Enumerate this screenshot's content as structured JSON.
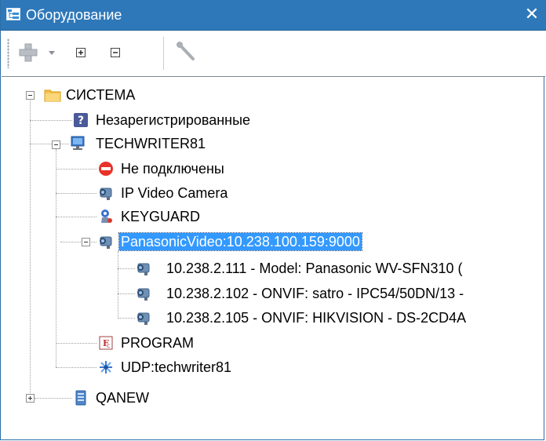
{
  "window": {
    "title": "Оборудование",
    "close_glyph": "✕"
  },
  "toolbar": {
    "add_icon": "add-device-icon",
    "expand_icon": "expand-all-icon",
    "collapse_icon": "collapse-all-icon",
    "tool_icon": "settings-tool-icon"
  },
  "tree": {
    "root": {
      "label": "СИСТЕМА",
      "icon": "folder-icon"
    },
    "unregistered": {
      "label": "Незарегистрированные",
      "icon": "question-icon"
    },
    "computer": {
      "label": "TECHWRITER81",
      "icon": "computer-icon"
    },
    "not_connected": {
      "label": "Не подключены",
      "icon": "no-entry-icon"
    },
    "ip_camera": {
      "label": "IP Video Camera",
      "icon": "camera-icon"
    },
    "keyguard": {
      "label": "KEYGUARD",
      "icon": "keyguard-icon"
    },
    "panasonic": {
      "label": "PanasonicVideo:10.238.100.159:9000",
      "icon": "camera-icon"
    },
    "cam1": {
      "label": "10.238.2.111 - Model: Panasonic WV-SFN310 (",
      "icon": "camera-icon"
    },
    "cam2": {
      "label": "10.238.2.102 - ONVIF: satro - IPC54/50DN/13 -",
      "icon": "camera-icon"
    },
    "cam3": {
      "label": "10.238.2.105 - ONVIF: HIKVISION - DS-2CD4A",
      "icon": "camera-icon"
    },
    "program": {
      "label": "PROGRAM",
      "icon": "program-icon"
    },
    "udp": {
      "label": "UDP:techwriter81",
      "icon": "network-icon"
    },
    "qanew": {
      "label": "QANEW",
      "icon": "server-icon"
    }
  }
}
